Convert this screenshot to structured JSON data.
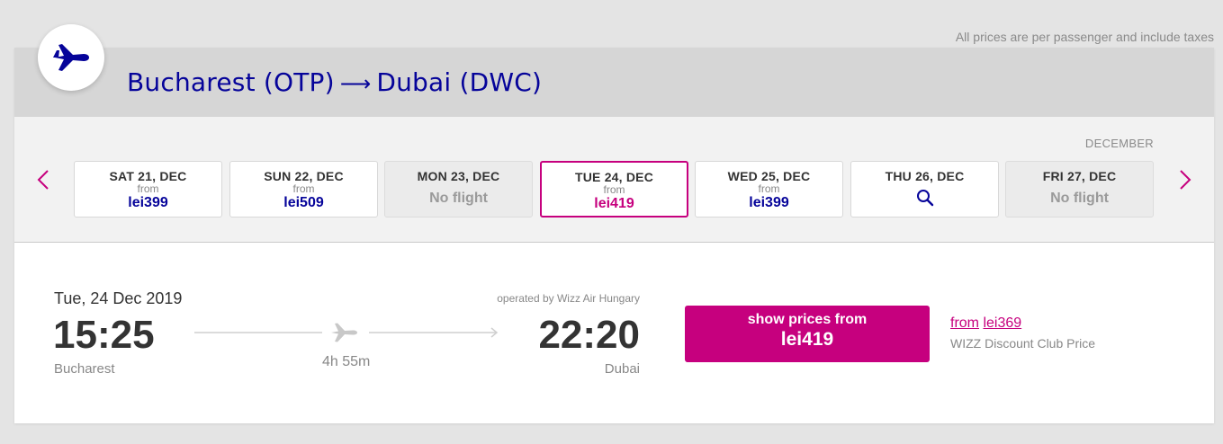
{
  "tax_note": "All prices are per passenger and include taxes",
  "route": {
    "origin": "Bucharest (OTP)",
    "arrow": "⟶",
    "destination": "Dubai (DWC)"
  },
  "calendar": {
    "month": "DECEMBER",
    "days": [
      {
        "label": "SAT 21, DEC",
        "from": "from",
        "price": "lei399",
        "state": "available"
      },
      {
        "label": "SUN 22, DEC",
        "from": "from",
        "price": "lei509",
        "state": "available"
      },
      {
        "label": "MON 23, DEC",
        "status": "No flight",
        "state": "disabled"
      },
      {
        "label": "TUE 24, DEC",
        "from": "from",
        "price": "lei419",
        "state": "selected"
      },
      {
        "label": "WED 25, DEC",
        "from": "from",
        "price": "lei399",
        "state": "available"
      },
      {
        "label": "THU 26, DEC",
        "icon": "search-icon",
        "state": "search"
      },
      {
        "label": "FRI 27, DEC",
        "status": "No flight",
        "state": "disabled"
      }
    ]
  },
  "flight": {
    "date": "Tue, 24 Dec 2019",
    "departure_time": "15:25",
    "departure_city": "Bucharest",
    "duration": "4h 55m",
    "operated_by": "operated by Wizz Air Hungary",
    "arrival_time": "22:20",
    "arrival_city": "Dubai"
  },
  "cta": {
    "line1": "show prices from",
    "price": "lei419"
  },
  "club": {
    "from": "from",
    "price": "lei369",
    "label": "WIZZ Discount Club Price"
  },
  "colors": {
    "brand_blue": "#06049a",
    "brand_magenta": "#c6007e"
  }
}
